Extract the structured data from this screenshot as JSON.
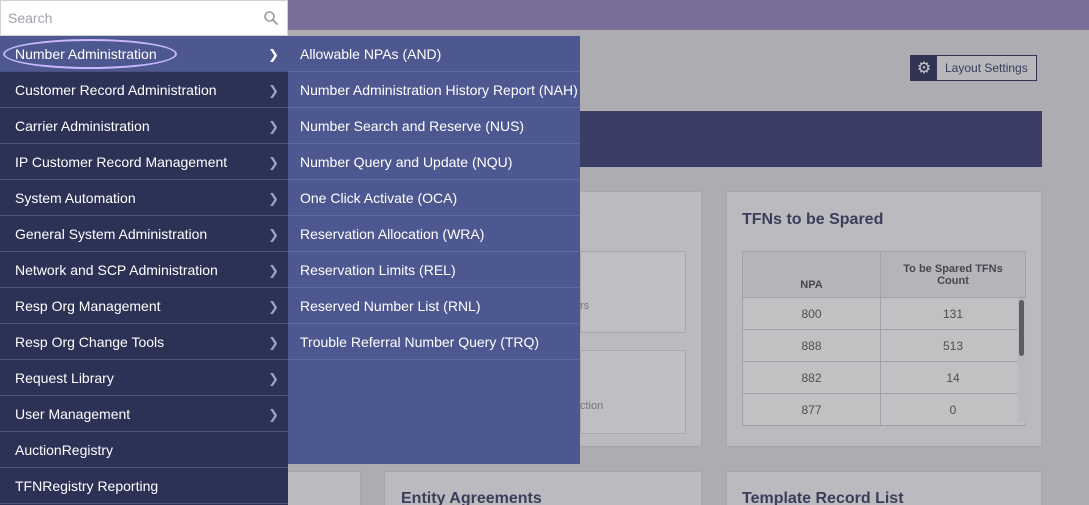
{
  "search": {
    "placeholder": "Search"
  },
  "menu": {
    "items": [
      {
        "label": "Number Administration",
        "has_sub": true
      },
      {
        "label": "Customer Record Administration",
        "has_sub": true
      },
      {
        "label": "Carrier Administration",
        "has_sub": true
      },
      {
        "label": "IP Customer Record Management",
        "has_sub": true
      },
      {
        "label": "System Automation",
        "has_sub": true
      },
      {
        "label": "General System Administration",
        "has_sub": true
      },
      {
        "label": "Network and SCP Administration",
        "has_sub": true
      },
      {
        "label": "Resp Org Management",
        "has_sub": true
      },
      {
        "label": "Resp Org Change Tools",
        "has_sub": true
      },
      {
        "label": "Request Library",
        "has_sub": true
      },
      {
        "label": "User Management",
        "has_sub": true
      },
      {
        "label": "AuctionRegistry",
        "has_sub": false
      },
      {
        "label": "TFNRegistry Reporting",
        "has_sub": false
      }
    ]
  },
  "submenu": {
    "items": [
      "Allowable NPAs (AND)",
      "Number Administration History Report (NAH)",
      "Number Search and Reserve (NUS)",
      "Number Query and Update (NQU)",
      "One Click Activate (OCA)",
      "Reservation Allocation (WRA)",
      "Reservation Limits (REL)",
      "Reserved Number List (RNL)",
      "Trouble Referral Number Query (TRQ)"
    ]
  },
  "toolbar": {
    "layout_settings": "Layout Settings"
  },
  "cards": {
    "tfn_spared": {
      "title": "TFNs to be Spared",
      "headers": [
        "NPA",
        "To be Spared TFNs Count"
      ],
      "rows": [
        [
          "800",
          "131"
        ],
        [
          "888",
          "513"
        ],
        [
          "882",
          "14"
        ],
        [
          "877",
          "0"
        ]
      ]
    },
    "entity_agreements": {
      "title": "Entity Agreements"
    },
    "template_record_list": {
      "title": "Template Record List"
    },
    "partial_text_1": "rs",
    "partial_text_2": "ction"
  },
  "colors": {
    "menu_bg": "#2c3255",
    "menu_active": "#4e5890",
    "topbar": "#7a6f9a",
    "highlight": "#c8b8ff"
  }
}
